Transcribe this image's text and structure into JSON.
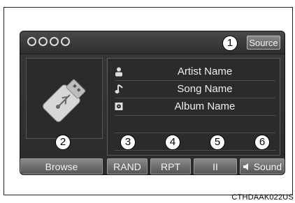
{
  "topbar": {
    "source_label": "Source"
  },
  "info": {
    "artist": "Artist Name",
    "song": "Song Name",
    "album": "Album Name"
  },
  "buttons": {
    "browse": "Browse",
    "rand": "RAND",
    "rpt": "RPT",
    "pause": "II",
    "sound": "Sound"
  },
  "callouts": [
    "1",
    "2",
    "3",
    "4",
    "5",
    "6"
  ],
  "caption": "CTHDAAK022US",
  "icons": {
    "artist": "person-icon",
    "song": "music-note-icon",
    "album": "album-icon",
    "usb": "usb-drive-icon",
    "sound": "speaker-icon"
  }
}
